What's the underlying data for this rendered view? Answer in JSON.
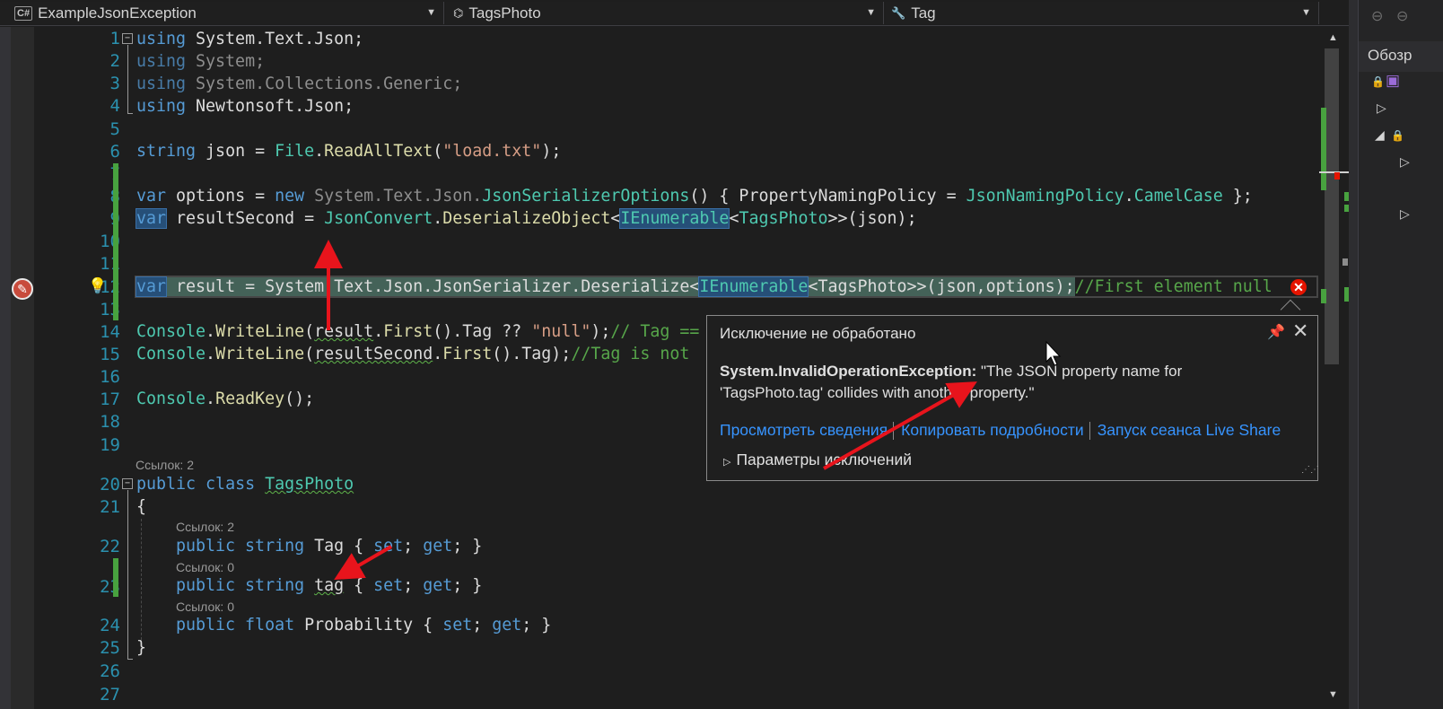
{
  "navbar": {
    "project": "ExampleJsonException",
    "class": "TagsPhoto",
    "member": "Tag",
    "project_icon": "csharp-file-icon",
    "class_icon": "class-icon",
    "member_icon": "wrench-icon"
  },
  "right_panel": {
    "header": "Обозр"
  },
  "code_lines": [
    {
      "n": "1"
    },
    {
      "n": "2"
    },
    {
      "n": "3"
    },
    {
      "n": "4"
    },
    {
      "n": "5"
    },
    {
      "n": "6"
    },
    {
      "n": "7"
    },
    {
      "n": "8"
    },
    {
      "n": "9"
    },
    {
      "n": "10"
    },
    {
      "n": "11"
    },
    {
      "n": "12"
    },
    {
      "n": "13"
    },
    {
      "n": "14"
    },
    {
      "n": "15"
    },
    {
      "n": "16"
    },
    {
      "n": "17"
    },
    {
      "n": "18"
    },
    {
      "n": "19"
    },
    {
      "n": "20"
    },
    {
      "n": "21"
    },
    {
      "n": "22"
    },
    {
      "n": "23"
    },
    {
      "n": "24"
    },
    {
      "n": "25"
    },
    {
      "n": "26"
    },
    {
      "n": "27"
    }
  ],
  "code": {
    "l1": {
      "kw": "using",
      "rest": " System.Text.Json;"
    },
    "l2": {
      "kw": "using",
      "rest": " System;"
    },
    "l3": {
      "kw": "using",
      "rest": " System.Collections.Generic;"
    },
    "l4": {
      "kw": "using",
      "rest": " Newtonsoft.Json;"
    },
    "l6": {
      "kw": "string",
      "a": " json = ",
      "t": "File",
      "d": ".",
      "m": "ReadAllText",
      "b": "(",
      "s": "\"load.txt\"",
      "c": ");"
    },
    "l8": {
      "kw": "var",
      "a": " options = ",
      "kw2": "new",
      "ns": " System.Text.Json.",
      "t": "JsonSerializerOptions",
      "b": "() { PropertyNamingPolicy = ",
      "t2": "JsonNamingPolicy",
      "d": ".",
      "p": "CamelCase",
      "c": " };"
    },
    "l9": {
      "kw": "var",
      "a": " resultSecond = ",
      "t": "JsonConvert",
      "d": ".",
      "m": "DeserializeObject",
      "lt": "<",
      "t2": "IEnumerable",
      "lt2": "<",
      "t3": "TagsPhoto",
      "c": ">>(json);"
    },
    "l12": {
      "kw": "var",
      "a": " result = System.Text.Json.JsonSerializer.Deserialize<",
      "t": "IEnumerable",
      "b": "<TagsPhoto>>(json,options);",
      "cm": "//First element null"
    },
    "l14": {
      "t": "Console",
      "d": ".",
      "m": "WriteLine",
      "a": "(",
      "u": "result",
      "b": ".",
      "m2": "First",
      "c": "().Tag ?? ",
      "s": "\"null\"",
      "e": ");",
      "cm": "// Tag =="
    },
    "l15": {
      "t": "Console",
      "d": ".",
      "m": "WriteLine",
      "a": "(",
      "u": "resultSecond",
      "b": ".",
      "m2": "First",
      "c": "().Tag);",
      "cm": "//Tag is not"
    },
    "l17": {
      "t": "Console",
      "d": ".",
      "m": "ReadKey",
      "c": "();"
    },
    "l20": {
      "kw": "public",
      "kw2": " class",
      "sp": " ",
      "t": "TagsPhoto"
    },
    "l21": {
      "a": "{"
    },
    "l22": {
      "kw": "public",
      "kw2": " string",
      "a": " Tag { ",
      "k1": "set",
      "b": "; ",
      "k2": "get",
      "c": "; }"
    },
    "l23": {
      "kw": "public",
      "kw2": " string",
      "sp": " ",
      "u": "tag",
      "a": " { ",
      "k1": "set",
      "b": "; ",
      "k2": "get",
      "c": "; }"
    },
    "l24": {
      "kw": "public",
      "kw2": " float",
      "a": " Probability { ",
      "k1": "set",
      "b": "; ",
      "k2": "get",
      "c": "; }"
    },
    "l25": {
      "a": "}"
    }
  },
  "refs": {
    "r20": "Ссылок: 2",
    "r22": "Ссылок: 2",
    "r23": "Ссылок: 0",
    "r24": "Ссылок: 0"
  },
  "exception": {
    "title": "Исключение не обработано",
    "type": "System.InvalidOperationException:",
    "message": " \"The JSON property name for 'TagsPhoto.tag' collides with another property.\"",
    "link_view": "Просмотреть сведения",
    "link_copy": "Копировать подробности",
    "link_liveshare": "Запуск сеанса Live Share",
    "settings": "Параметры исключений",
    "pin_icon": "pin-icon",
    "close_icon": "close-icon"
  },
  "colors": {
    "keyword": "#569cd6",
    "type": "#4ec9b0",
    "method": "#dcdcaa",
    "string": "#d69d85",
    "comment": "#57a64a",
    "line_number": "#2b91af",
    "link": "#3794ff",
    "change_bar": "#48a23f",
    "error": "#e51400",
    "annotation_arrow": "#e8141c"
  }
}
